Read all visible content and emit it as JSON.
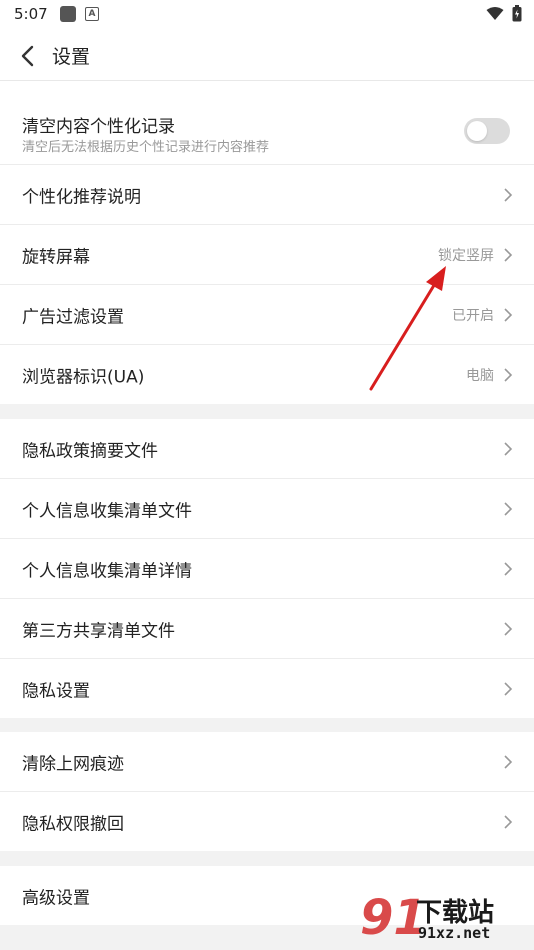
{
  "status": {
    "time": "5:07",
    "app_badge": "A"
  },
  "header": {
    "title": "设置"
  },
  "sections": [
    {
      "rows": [
        {
          "label": "清空内容个性化记录",
          "sub": "清空后无法根据历史个性记录进行内容推荐",
          "toggle": false
        },
        {
          "label": "个性化推荐说明",
          "value": ""
        },
        {
          "label": "旋转屏幕",
          "value": "锁定竖屏"
        },
        {
          "label": "广告过滤设置",
          "value": "已开启"
        },
        {
          "label": "浏览器标识(UA)",
          "value": "电脑"
        }
      ]
    },
    {
      "rows": [
        {
          "label": "隐私政策摘要文件"
        },
        {
          "label": "个人信息收集清单文件"
        },
        {
          "label": "个人信息收集清单详情"
        },
        {
          "label": "第三方共享清单文件"
        },
        {
          "label": "隐私设置"
        }
      ]
    },
    {
      "rows": [
        {
          "label": "清除上网痕迹"
        },
        {
          "label": "隐私权限撤回"
        }
      ]
    },
    {
      "rows": [
        {
          "label": "高级设置"
        }
      ]
    }
  ],
  "watermark": {
    "logo": "91",
    "title": "下载站",
    "url": "91xz.net"
  },
  "colors": {
    "annotation_arrow": "#d81e1e",
    "background": "#f2f2f2"
  }
}
